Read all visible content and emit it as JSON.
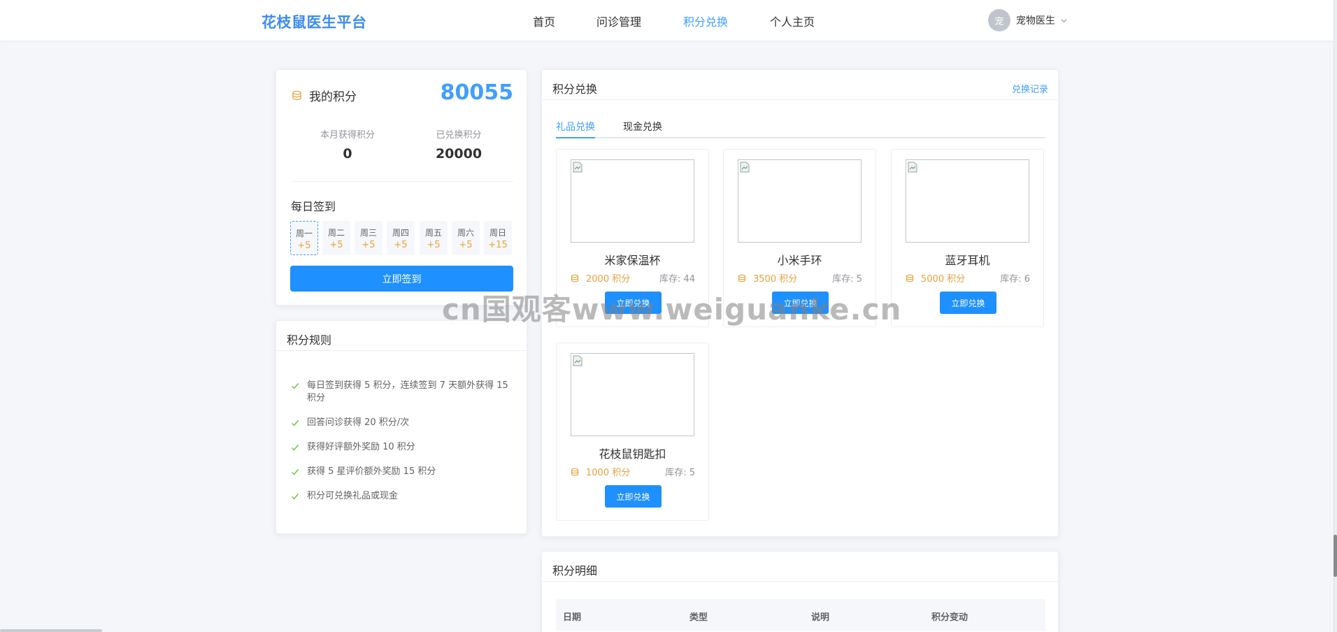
{
  "header": {
    "logo": "花枝鼠医生平台",
    "nav": [
      {
        "label": "首页",
        "active": false
      },
      {
        "label": "问诊管理",
        "active": false
      },
      {
        "label": "积分兑换",
        "active": true
      },
      {
        "label": "个人主页",
        "active": false
      }
    ],
    "user": {
      "avatar_text": "宠",
      "name": "宠物医生"
    }
  },
  "points": {
    "title": "我的积分",
    "total": "80055",
    "month_label": "本月获得积分",
    "month_value": "0",
    "redeemed_label": "已兑换积分",
    "redeemed_value": "20000",
    "signin_title": "每日签到",
    "days": [
      {
        "name": "周一",
        "bonus": "+5",
        "current": true
      },
      {
        "name": "周二",
        "bonus": "+5",
        "current": false
      },
      {
        "name": "周三",
        "bonus": "+5",
        "current": false
      },
      {
        "name": "周四",
        "bonus": "+5",
        "current": false
      },
      {
        "name": "周五",
        "bonus": "+5",
        "current": false
      },
      {
        "name": "周六",
        "bonus": "+5",
        "current": false
      },
      {
        "name": "周日",
        "bonus": "+15",
        "current": false
      }
    ],
    "signin_button": "立即签到"
  },
  "rules": {
    "title": "积分规则",
    "items": [
      "每日签到获得 5 积分，连续签到 7 天额外获得 15 积分",
      "回答问诊获得 20 积分/次",
      "获得好评额外奖励 10 积分",
      "获得 5 星评价额外奖励 15 积分",
      "积分可兑换礼品或现金"
    ]
  },
  "exchange": {
    "title": "积分兑换",
    "history_link": "兑换记录",
    "tabs": [
      {
        "label": "礼品兑换",
        "active": true
      },
      {
        "label": "现金兑换",
        "active": false
      }
    ],
    "products": [
      {
        "name": "米家保温杯",
        "points": "2000 积分",
        "stock": "库存: 44",
        "button": "立即兑换"
      },
      {
        "name": "小米手环",
        "points": "3500 积分",
        "stock": "库存: 5",
        "button": "立即兑换"
      },
      {
        "name": "蓝牙耳机",
        "points": "5000 积分",
        "stock": "库存: 6",
        "button": "立即兑换"
      },
      {
        "name": "花枝鼠钥匙扣",
        "points": "1000 积分",
        "stock": "库存: 5",
        "button": "立即兑换"
      }
    ]
  },
  "detail": {
    "title": "积分明细",
    "columns": [
      "日期",
      "类型",
      "说明",
      "积分变动"
    ]
  },
  "watermark": "cn国观客www.weiguanke.cn",
  "colors": {
    "primary": "#409eff",
    "button": "#1e90ff",
    "points": "#e6a23c",
    "check": "#67c23a"
  }
}
